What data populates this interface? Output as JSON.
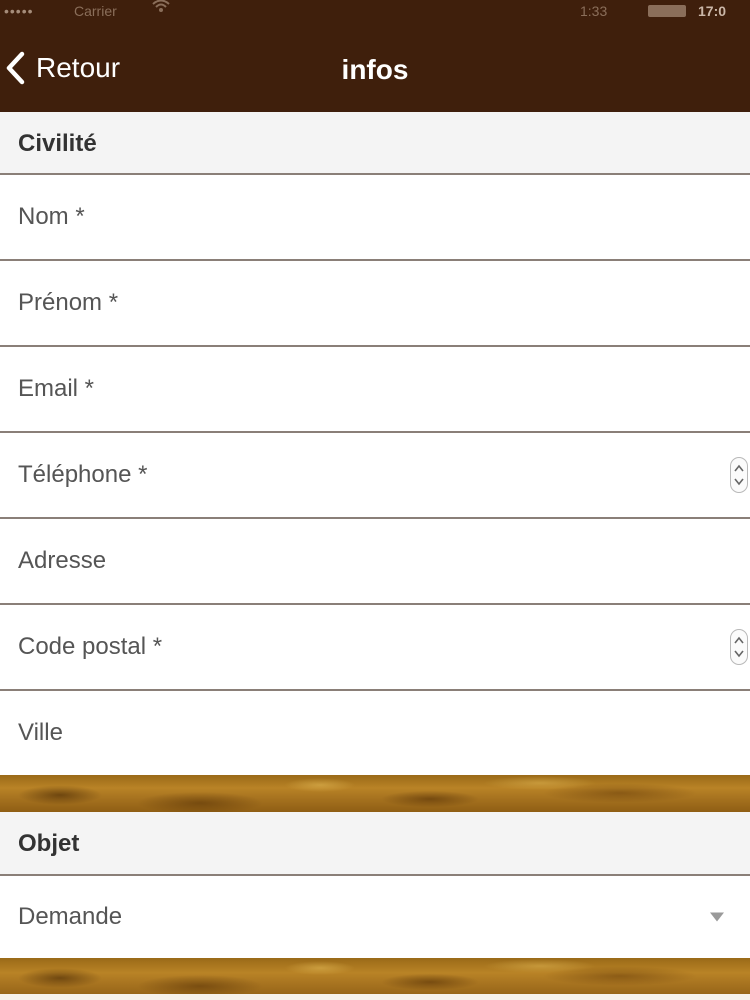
{
  "status_bar": {
    "signal": "•••••",
    "carrier": "Carrier",
    "wifi_icon": "wifi-icon",
    "clock": "1:33",
    "battery_icon": "battery-icon",
    "time": "17:0"
  },
  "nav": {
    "back_icon": "chevron-left-icon",
    "back_label": "Retour",
    "title": "infos"
  },
  "sections": {
    "civilite": "Civilité",
    "objet": "Objet"
  },
  "fields": {
    "nom": {
      "placeholder": "Nom *"
    },
    "prenom": {
      "placeholder": "Prénom *"
    },
    "email": {
      "placeholder": "Email *"
    },
    "telephone": {
      "placeholder": "Téléphone *",
      "stepper_icon": "stepper-icon"
    },
    "adresse": {
      "placeholder": "Adresse"
    },
    "code_postal": {
      "placeholder": "Code postal *",
      "stepper_icon": "stepper-icon"
    },
    "ville": {
      "placeholder": "Ville"
    }
  },
  "objet": {
    "selected": "Demande",
    "dropdown_icon": "dropdown-arrow-icon"
  },
  "colors": {
    "nav_background": "#3f1f0c",
    "section_background": "#f4f4f4",
    "divider": "#8a7f78",
    "placeholder_text": "#555555",
    "wood": "#b98326"
  }
}
